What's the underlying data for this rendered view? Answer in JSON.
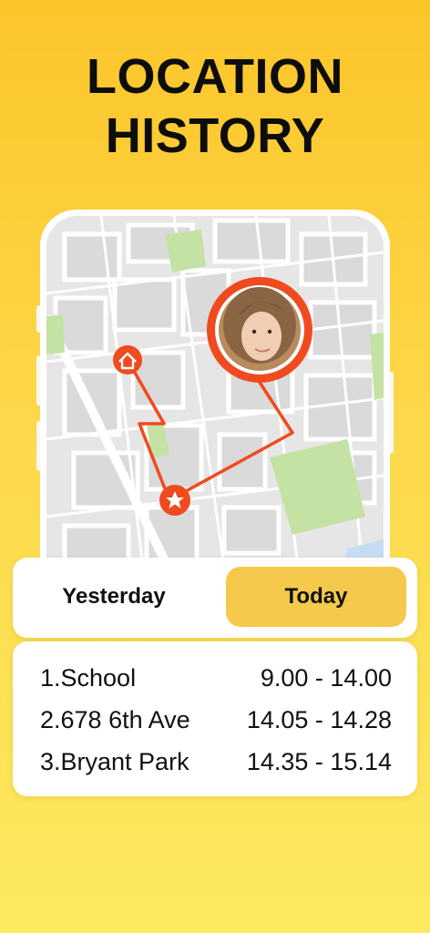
{
  "title": {
    "line1": "LOCATION",
    "line2": "HISTORY"
  },
  "colors": {
    "accent_route": "#f04a1f",
    "tab_active": "#f5c94b",
    "background_top": "#fcc52a",
    "background_bottom": "#fde95f"
  },
  "map": {
    "markers": [
      "home-icon",
      "star-icon",
      "avatar-pin"
    ]
  },
  "tabs": [
    {
      "label": "Yesterday",
      "active": false
    },
    {
      "label": "Today",
      "active": true
    }
  ],
  "history": [
    {
      "place": "1.School",
      "time": "9.00 - 14.00"
    },
    {
      "place": "2.678 6th Ave",
      "time": "14.05 - 14.28"
    },
    {
      "place": "3.Bryant Park",
      "time": "14.35 - 15.14"
    }
  ]
}
